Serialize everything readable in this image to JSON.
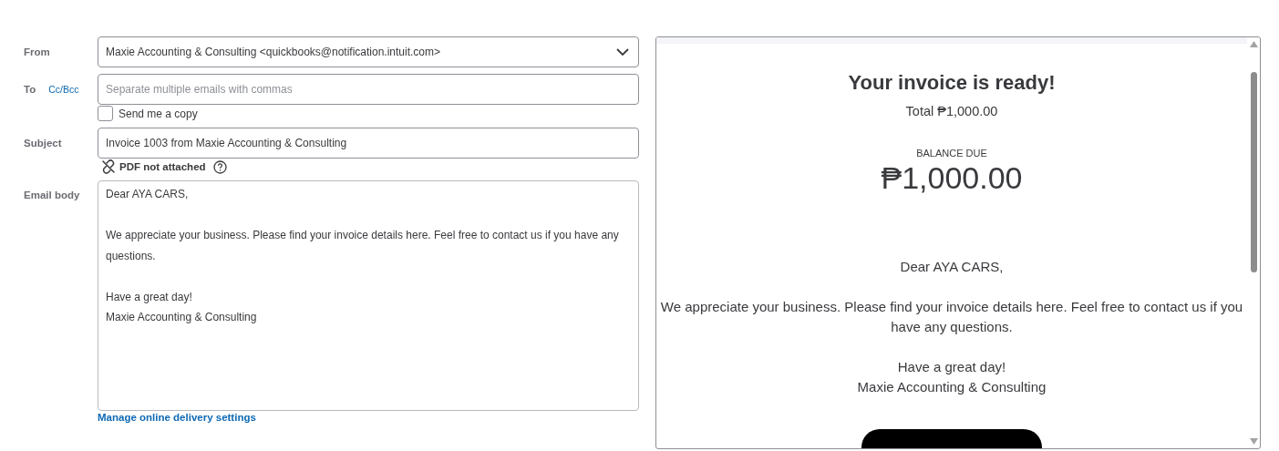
{
  "form": {
    "from": {
      "label": "From",
      "value": "Maxie Accounting & Consulting <quickbooks@notification.intuit.com>"
    },
    "to": {
      "label": "To",
      "cc_bcc_link": "Cc/Bcc",
      "placeholder": "Separate multiple emails with commas"
    },
    "send_copy": {
      "label": "Send me a copy",
      "checked": false
    },
    "subject": {
      "label": "Subject",
      "value": "Invoice 1003 from Maxie Accounting & Consulting"
    },
    "pdf_status": "PDF not attached",
    "email_body": {
      "label": "Email body",
      "paragraphs": [
        [
          "Dear AYA CARS,"
        ],
        [
          "We appreciate your business. Please find your invoice details here. Feel free to contact us if you have any questions."
        ],
        [
          "Have a great day!",
          "Maxie Accounting & Consulting"
        ]
      ]
    },
    "delivery_link": "Manage online delivery settings"
  },
  "preview": {
    "title": "Your invoice is ready!",
    "total": "Total ₱1,000.00",
    "balance_label": "BALANCE DUE",
    "balance_amount": "₱1,000.00",
    "paragraphs": [
      [
        "Dear AYA CARS,"
      ],
      [
        "We appreciate your business. Please find your invoice details here. Feel free to contact us if you have any questions."
      ],
      [
        "Have a great day!",
        "Maxie Accounting & Consulting"
      ]
    ]
  }
}
